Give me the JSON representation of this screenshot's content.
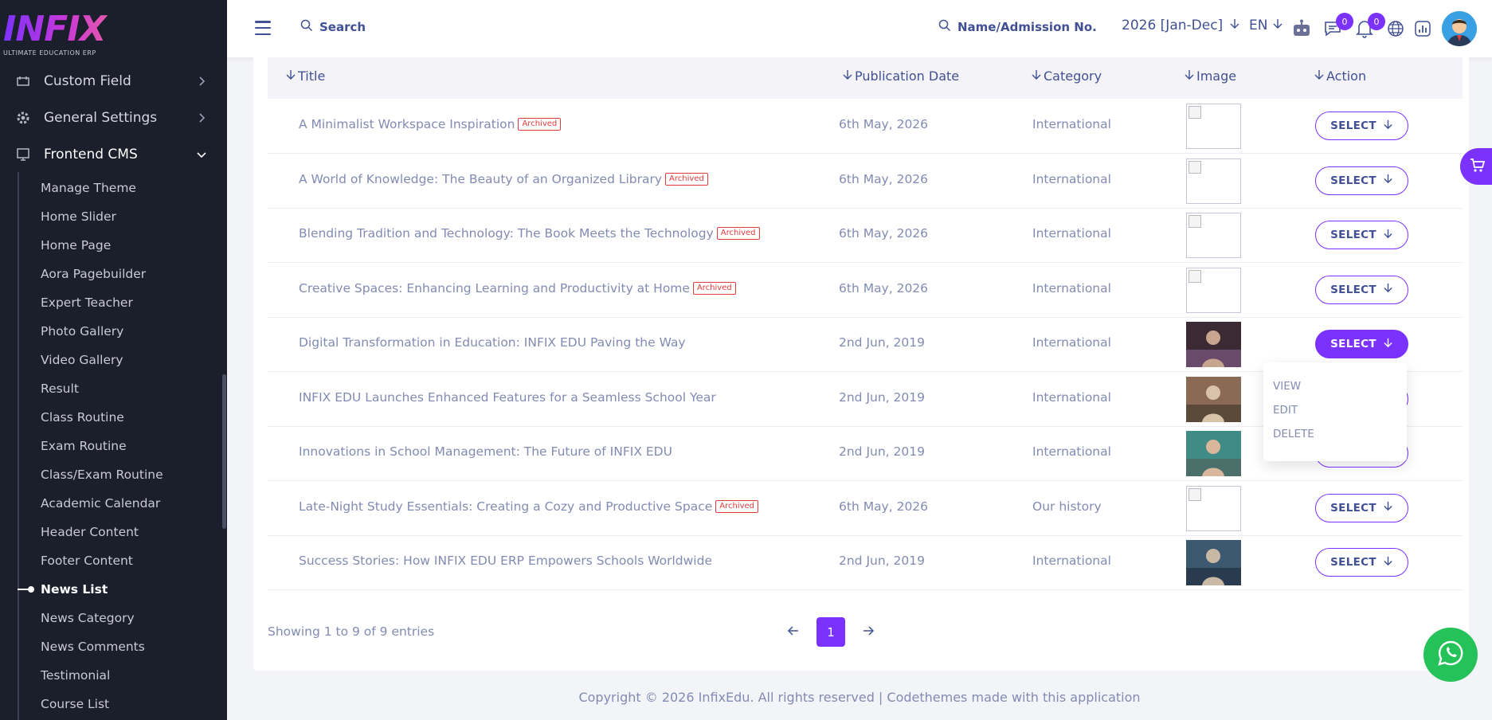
{
  "brand": {
    "logo_text": "INFIX",
    "logo_sub": "ULTIMATE EDUCATION ERP"
  },
  "sidebar": {
    "menu": [
      {
        "label": "Custom Field",
        "icon": "custom-field-icon"
      },
      {
        "label": "General Settings",
        "icon": "gear-icon"
      },
      {
        "label": "Frontend CMS",
        "icon": "cms-icon"
      }
    ],
    "submenu": [
      "Manage Theme",
      "Home Slider",
      "Home Page",
      "Aora Pagebuilder",
      "Expert Teacher",
      "Photo Gallery",
      "Video Gallery",
      "Result",
      "Class Routine",
      "Exam Routine",
      "Class/Exam Routine",
      "Academic Calendar",
      "Header Content",
      "Footer Content",
      "News List",
      "News Category",
      "News Comments",
      "Testimonial",
      "Course List"
    ],
    "active_submenu": "News List"
  },
  "topbar": {
    "search_label": "Search",
    "search2_label": "Name/Admission No.",
    "year": "2026 [Jan-Dec]",
    "lang": "EN",
    "chat_badge": "0",
    "notif_badge": "0"
  },
  "table": {
    "headers": {
      "title": "Title",
      "date": "Publication Date",
      "category": "Category",
      "image": "Image",
      "action": "Action"
    },
    "archived_label": "Archived",
    "select_label": "SELECT",
    "rows": [
      {
        "title": "A Minimalist Workspace Inspiration",
        "archived": true,
        "date": "6th May, 2026",
        "category": "International",
        "image": "broken"
      },
      {
        "title": "A World of Knowledge: The Beauty of an Organized Library",
        "archived": true,
        "date": "6th May, 2026",
        "category": "International",
        "image": "broken"
      },
      {
        "title": "Blending Tradition and Technology: The Book Meets the Technology",
        "archived": true,
        "date": "6th May, 2026",
        "category": "International",
        "image": "broken"
      },
      {
        "title": "Creative Spaces: Enhancing Learning and Productivity at Home",
        "archived": true,
        "date": "6th May, 2026",
        "category": "International",
        "image": "broken"
      },
      {
        "title": "Digital Transformation in Education: INFIX EDU Paving the Way",
        "archived": false,
        "date": "2nd Jun, 2019",
        "category": "International",
        "image": "photo-1"
      },
      {
        "title": "INFIX EDU Launches Enhanced Features for a Seamless School Year",
        "archived": false,
        "date": "2nd Jun, 2019",
        "category": "International",
        "image": "photo-2"
      },
      {
        "title": "Innovations in School Management: The Future of INFIX EDU",
        "archived": false,
        "date": "2nd Jun, 2019",
        "category": "International",
        "image": "photo-3"
      },
      {
        "title": "Late-Night Study Essentials: Creating a Cozy and Productive Space",
        "archived": true,
        "date": "6th May, 2026",
        "category": "Our history",
        "image": "broken"
      },
      {
        "title": "Success Stories: How INFIX EDU ERP Empowers Schools Worldwide",
        "archived": false,
        "date": "2nd Jun, 2019",
        "category": "International",
        "image": "photo-4"
      }
    ]
  },
  "dropdown": {
    "items": [
      "VIEW",
      "EDIT",
      "DELETE"
    ]
  },
  "pagination": {
    "showing": "Showing 1 to 9 of 9 entries",
    "current": "1"
  },
  "footer": {
    "text": "Copyright © 2026 InfixEdu. All rights reserved | Codethemes made with this application"
  },
  "colors": {
    "accent": "#7c32ff",
    "sidebar_bg": "#1b1e2b",
    "archived": "#e23b3b",
    "whatsapp": "#25c25a"
  }
}
